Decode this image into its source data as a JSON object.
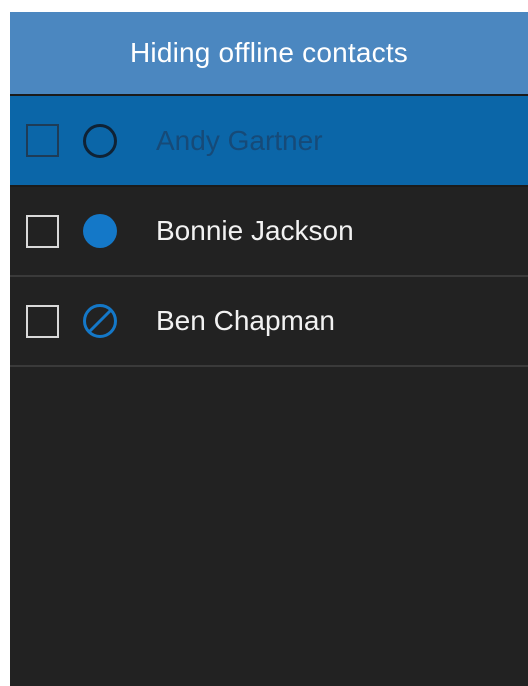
{
  "header": {
    "title": "Hiding offline contacts"
  },
  "contacts": [
    {
      "name": "Andy Gartner",
      "status_icon": "offline-circle-icon",
      "checked": false,
      "selected": true
    },
    {
      "name": "Bonnie Jackson",
      "status_icon": "online-dot-icon",
      "checked": false,
      "selected": false
    },
    {
      "name": "Ben Chapman",
      "status_icon": "do-not-disturb-icon",
      "checked": false,
      "selected": false
    }
  ],
  "colors": {
    "header_bg": "#4b87c0",
    "selected_row_bg": "#0b66a8",
    "panel_bg": "#222222",
    "status_blue": "#1478c8"
  }
}
